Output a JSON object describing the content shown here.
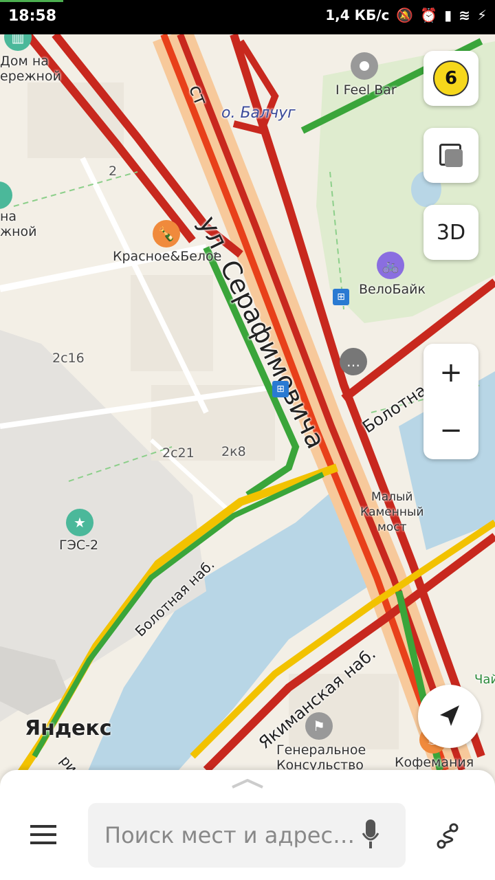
{
  "status_bar": {
    "time": "18:58",
    "network_speed": "1,4 КБ/с",
    "icons": [
      "mute-icon",
      "alarm-icon",
      "signal-icon",
      "wifi-icon",
      "charging-icon"
    ]
  },
  "map": {
    "street_labels": {
      "serafimovicha": "ул. Серафимовича",
      "bolotnaya_top": "Болотная наб.",
      "bolotnaya_left": "Болотная наб.",
      "yakimanskaya": "Якиманская наб.",
      "most": "ст",
      "balchug": "о. Балчуг",
      "chay": "Чай"
    },
    "pois": {
      "dom_na_naberezhnoy": "Дом на\nережной",
      "dom_left": "на\nжной",
      "krasnoe_beloe": "Красное&Белое",
      "i_feel_bar": "I Feel Bar",
      "velobike": "ВелоБайк",
      "ges2": "ГЭС-2",
      "consulate": "Генеральное\nКонсульство",
      "kofemania": "Кофемания",
      "maly_kamenny": "Малый\nКаменный\nмост"
    },
    "house_numbers": {
      "n2": "2",
      "n2c16": "2с16",
      "n2c21": "2с21",
      "n2k8": "2к8"
    },
    "brand": "Яндекс",
    "brand_suffix": "риар"
  },
  "controls": {
    "traffic_score": "6",
    "layers_icon": "layers-icon",
    "mode_3d": "3D",
    "zoom_in": "+",
    "zoom_out": "−"
  },
  "bottom_panel": {
    "search_placeholder": "Поиск мест и адрес…",
    "menu_icon": "menu-icon",
    "mic_icon": "microphone-icon",
    "route_icon": "route-icon"
  },
  "colors": {
    "traffic_red": "#c8281e",
    "traffic_orange": "#e8401a",
    "traffic_green": "#3aa53a",
    "traffic_yellow": "#f2c200",
    "water": "#b8d6e6",
    "park": "#e4efd8"
  }
}
